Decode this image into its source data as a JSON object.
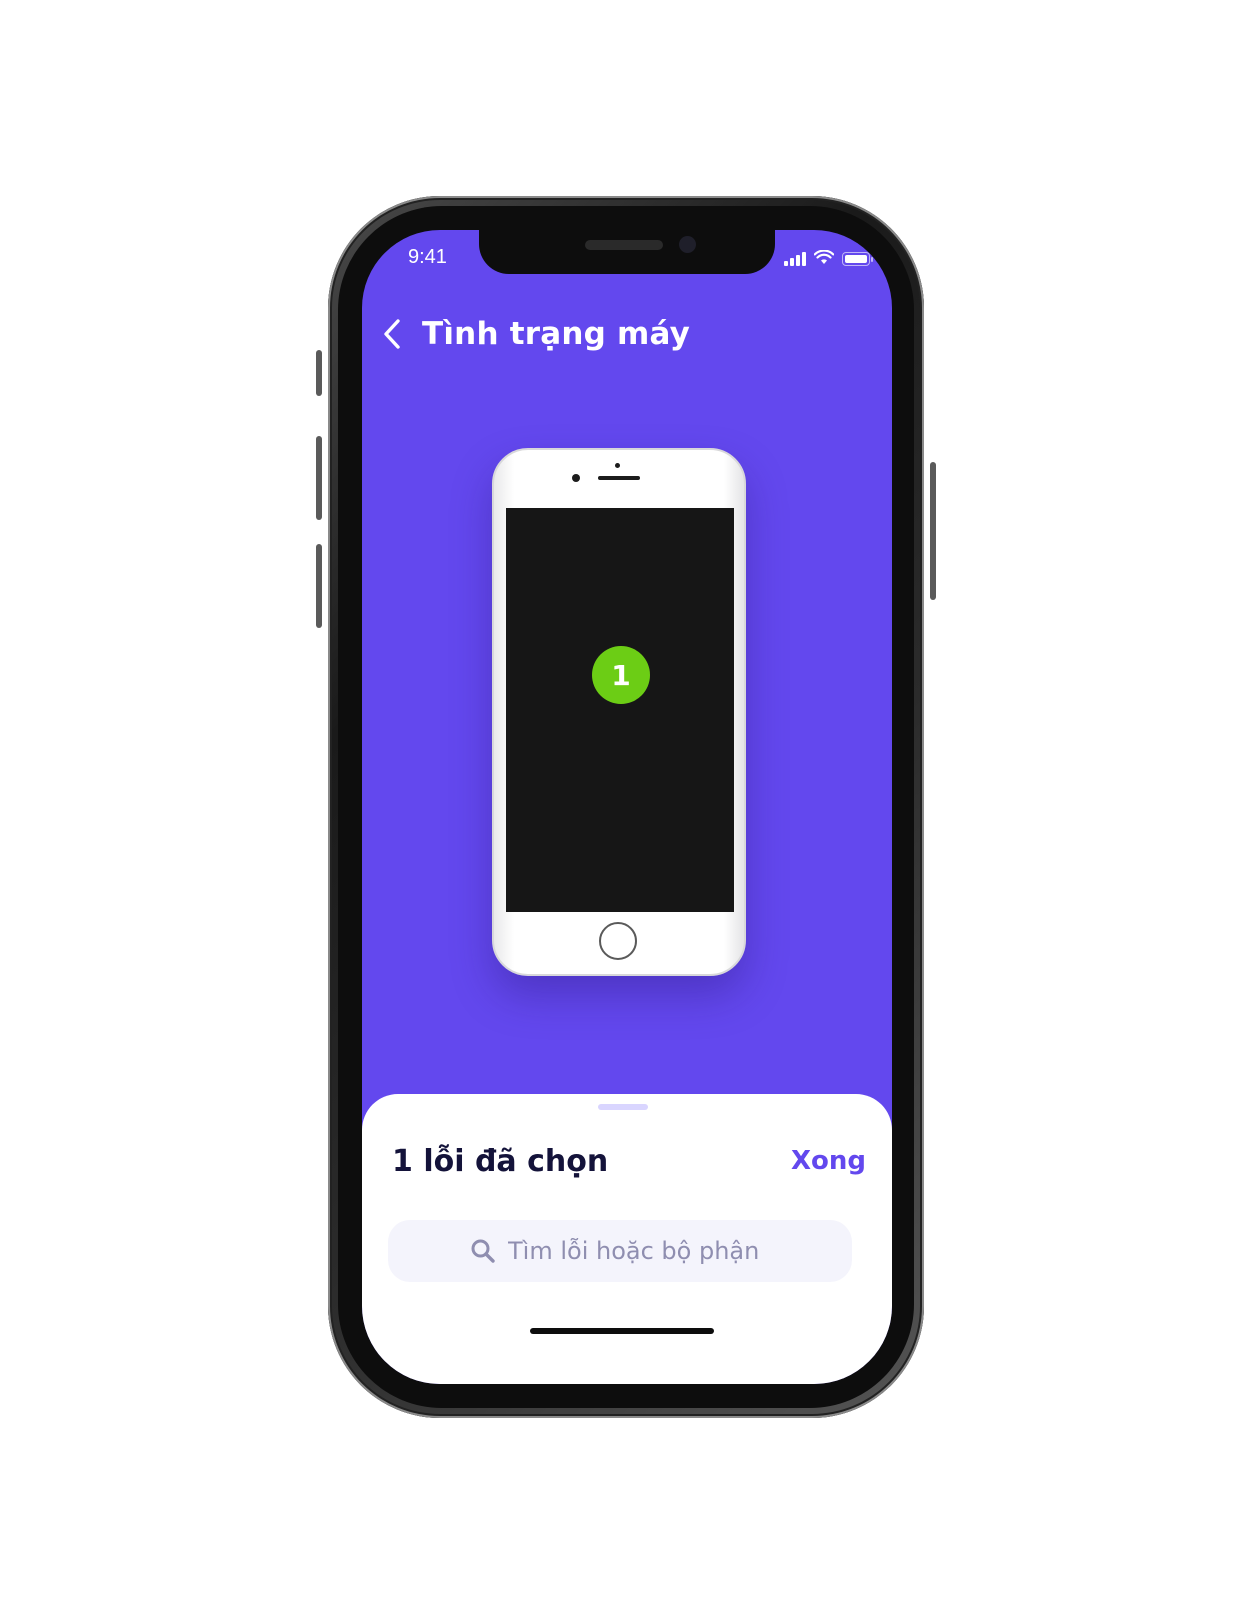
{
  "status_bar": {
    "time": "9:41"
  },
  "nav": {
    "title": "Tình trạng máy",
    "back_icon": "chevron-left-icon"
  },
  "illustration": {
    "fault_count_marker": "1",
    "marker_color": "#6ccd15"
  },
  "sheet": {
    "title": "1 lỗi đã chọn",
    "done_label": "Xong",
    "search_placeholder": "Tìm lỗi hoặc bộ phận",
    "search_value": ""
  },
  "colors": {
    "brand": "#6348ee",
    "sheet_title": "#14133a",
    "placeholder": "#8f8eb0"
  }
}
